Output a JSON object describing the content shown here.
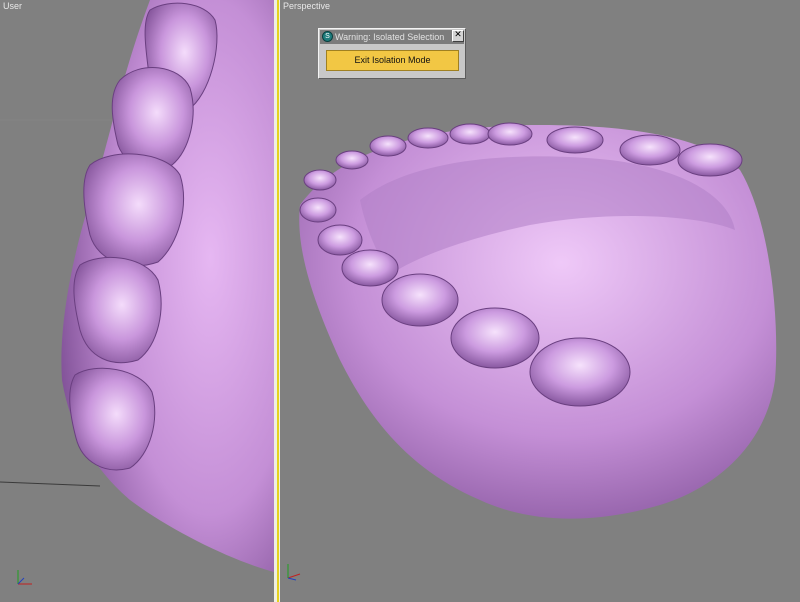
{
  "viewports": {
    "left": {
      "label": "User"
    },
    "right": {
      "label": "Perspective"
    }
  },
  "isolation_dialog": {
    "title": "Warning: Isolated Selection",
    "exit_button_label": "Exit Isolation Mode",
    "close_glyph": "✕"
  },
  "colors": {
    "model": "#c58fd6",
    "active_viewport_border": "#e6d21e",
    "exit_button": "#f2c744"
  },
  "icons": [
    "app-logo-icon",
    "close-icon",
    "axis-tripod-icon"
  ]
}
